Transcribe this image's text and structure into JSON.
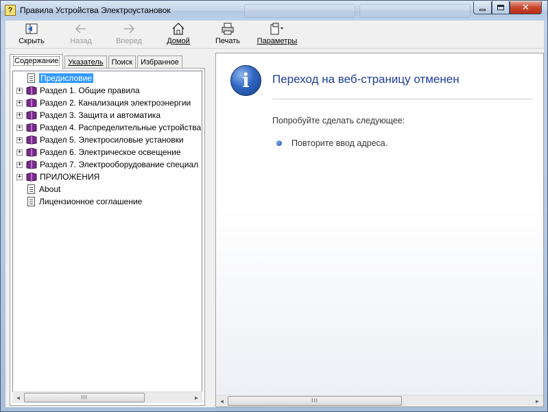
{
  "window": {
    "title": "Правила Устройства Электроустановок",
    "close_glyph": "✕"
  },
  "toolbar": {
    "hide": "Скрыть",
    "back": "Назад",
    "forward": "Вперед",
    "home": "Домой",
    "print": "Печать",
    "options": "Параметры"
  },
  "tabs": [
    "Содержание",
    "Указатель",
    "Поиск",
    "Избранное"
  ],
  "tree": [
    {
      "label": "Предисловие",
      "type": "page",
      "expandable": false,
      "selected": true
    },
    {
      "label": "Раздел 1. Общие правила",
      "type": "book",
      "expandable": true
    },
    {
      "label": "Раздел 2. Канализация электроэнергии",
      "type": "book",
      "expandable": true
    },
    {
      "label": "Раздел 3. Защита и автоматика",
      "type": "book",
      "expandable": true
    },
    {
      "label": "Раздел 4. Распределительные устройства",
      "type": "book",
      "expandable": true
    },
    {
      "label": "Раздел 5. Электросиловые установки",
      "type": "book",
      "expandable": true
    },
    {
      "label": "Раздел 6. Электрическое освещение",
      "type": "book",
      "expandable": true
    },
    {
      "label": "Раздел 7. Электрооборудование специал",
      "type": "book",
      "expandable": true
    },
    {
      "label": "ПРИЛОЖЕНИЯ",
      "type": "book",
      "expandable": true
    },
    {
      "label": "About",
      "type": "page",
      "expandable": false
    },
    {
      "label": "Лицензионное соглашение",
      "type": "page",
      "expandable": false
    }
  ],
  "content": {
    "title": "Переход на веб-страницу отменен",
    "subtitle": "Попробуйте сделать следующее:",
    "bullet": "Повторите ввод адреса.",
    "info_glyph": "i"
  },
  "scrollbar": {
    "grip": "III",
    "left_arrow": "◄",
    "right_arrow": "►"
  },
  "tree_expander": "+",
  "colors": {
    "link_title": "#1f3d9b",
    "selection": "#3399ff",
    "book": "#7b2a8c"
  }
}
